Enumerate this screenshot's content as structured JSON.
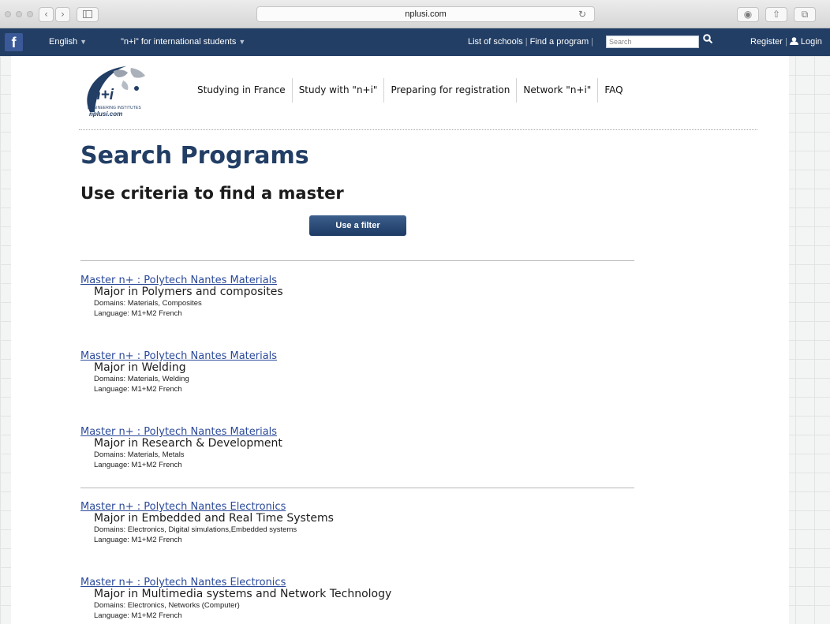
{
  "browser": {
    "url": "nplusi.com"
  },
  "navbar": {
    "facebook": "f",
    "language": "English",
    "intl_menu": "\"n+i\" for international students",
    "list_schools": "List of schools",
    "separator": "|",
    "find_program": "Find a program",
    "search_placeholder": "Search",
    "register": "Register",
    "login": "Login"
  },
  "logo": {
    "name": "n+i",
    "subtitle": "ENGINEERING INSTITUTES",
    "site": "nplusi.com"
  },
  "menu": [
    {
      "label": "Studying in France"
    },
    {
      "label": "Study with \"n+i\""
    },
    {
      "label": "Preparing for registration"
    },
    {
      "label": "Network \"n+i\""
    },
    {
      "label": "FAQ"
    }
  ],
  "page": {
    "title": "Search Programs",
    "subtitle": "Use criteria to find a master",
    "filter_button": "Use a filter"
  },
  "programs": [
    {
      "title": "Master n+ : Polytech Nantes Materials",
      "major": "Major in Polymers and composites",
      "domains": "Domains: Materials, Composites",
      "language": "Language: M1+M2 French"
    },
    {
      "title": "Master n+ : Polytech Nantes Materials",
      "major": "Major in Welding",
      "domains": "Domains: Materials, Welding",
      "language": "Language: M1+M2 French"
    },
    {
      "title": "Master n+ : Polytech Nantes Materials",
      "major": "Major in Research & Development",
      "domains": "Domains: Materials, Metals",
      "language": "Language: M1+M2 French"
    },
    {
      "title": "Master n+ : Polytech Nantes Electronics",
      "major": "Major in Embedded and Real Time Systems",
      "domains": "Domains: Electronics, Digital simulations,Embedded systems",
      "language": "Language: M1+M2 French"
    },
    {
      "title": "Master n+ : Polytech Nantes Electronics",
      "major": "Major in Multimedia systems and Network Technology",
      "domains": "Domains: Electronics, Networks (Computer)",
      "language": "Language: M1+M2 French"
    }
  ],
  "colors": {
    "navbar": "#223e65",
    "title": "#223e65",
    "link": "#2b4a9a",
    "button": "#1c3a64"
  }
}
